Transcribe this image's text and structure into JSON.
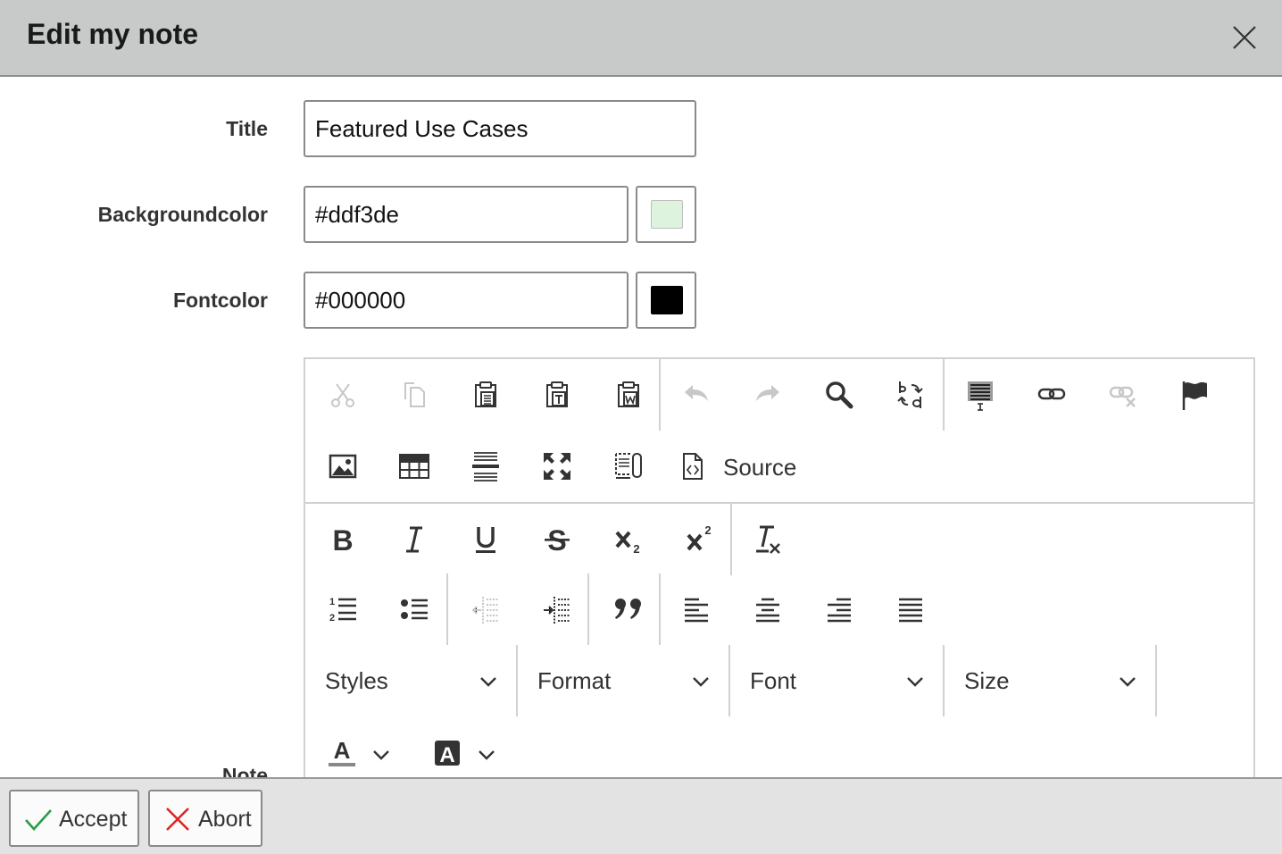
{
  "dialog": {
    "title": "Edit my note"
  },
  "form": {
    "title_label": "Title",
    "title_value": "Featured Use Cases",
    "bg_label": "Backgroundcolor",
    "bg_value": "#ddf3de",
    "bg_swatch": "#ddf3de",
    "font_label": "Fontcolor",
    "font_value": "#000000",
    "font_swatch": "#000000",
    "note_label": "Note"
  },
  "editor": {
    "toolbar_row1": [
      "cut-icon",
      "copy-icon",
      "paste-icon",
      "paste-text-icon",
      "paste-word-icon",
      "undo-icon",
      "redo-icon",
      "find-icon",
      "replace-icon",
      "select-all-icon",
      "link-icon",
      "unlink-icon",
      "anchor-icon"
    ],
    "toolbar_row2": [
      "image-icon",
      "table-icon",
      "horizontal-line-icon",
      "maximize-icon",
      "show-blocks-icon",
      "source-icon"
    ],
    "source_label": "Source",
    "toolbar_row3": [
      "bold-icon",
      "italic-icon",
      "underline-icon",
      "strikethrough-icon",
      "subscript-icon",
      "superscript-icon",
      "remove-format-icon"
    ],
    "toolbar_row4": [
      "numbered-list-icon",
      "bulleted-list-icon",
      "outdent-icon",
      "indent-icon",
      "blockquote-icon",
      "align-left-icon",
      "align-center-icon",
      "align-right-icon",
      "justify-icon"
    ],
    "combos": {
      "styles": "Styles",
      "format": "Format",
      "font": "Font",
      "size": "Size"
    },
    "toolbar_row6": [
      "text-color-icon",
      "background-color-icon"
    ]
  },
  "footer": {
    "accept_label": "Accept",
    "abort_label": "Abort"
  },
  "colors": {
    "header_bg": "#c8c9c9",
    "footer_bg": "#e3e3e3",
    "accept_check": "#2e9a46",
    "abort_x": "#e02424",
    "icon": "#333333",
    "icon_disabled": "#c7c7c7"
  }
}
